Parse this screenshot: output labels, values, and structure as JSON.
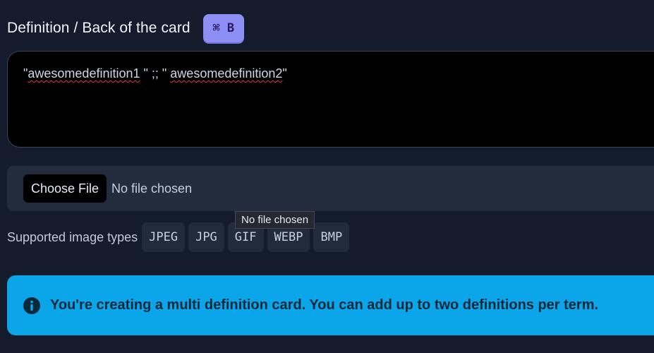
{
  "definition": {
    "label": "Definition / Back of the card",
    "shortcut": "⌘ B",
    "value_parts": [
      "\"",
      "awesomedefinition1",
      " \" ;; \" ",
      "awesomedefinition2",
      "\""
    ]
  },
  "file_input": {
    "button_label": "Choose File",
    "status": "No file chosen",
    "tooltip": "No file chosen"
  },
  "image_types": {
    "label": "Supported image types",
    "types": [
      "JPEG",
      "JPG",
      "GIF",
      "WEBP",
      "BMP"
    ]
  },
  "alert": {
    "icon": "info-circle-icon",
    "message": "You're creating a multi definition card. You can add up to two definitions per term.",
    "color": "#0ba5e9"
  }
}
